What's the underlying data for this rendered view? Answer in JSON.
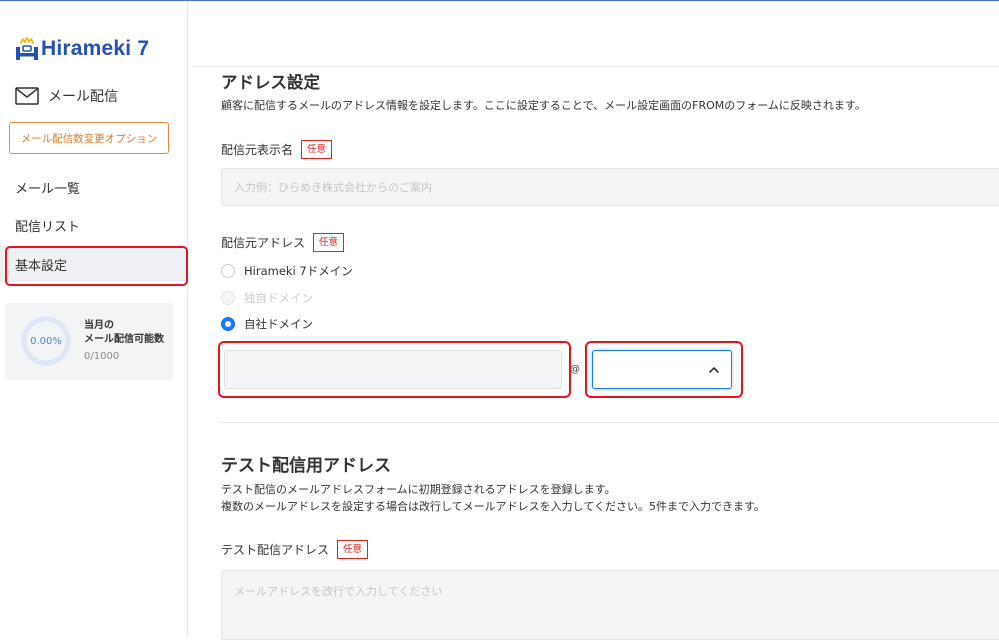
{
  "app": {
    "logo_text": "Hirameki",
    "logo_version": "7"
  },
  "sidebar": {
    "mail_label": "メール配信",
    "option_button": "メール配信数変更オプション",
    "items": [
      {
        "label": "メール一覧"
      },
      {
        "label": "配信リスト"
      },
      {
        "label": "基本設定"
      }
    ],
    "usage": {
      "percent_text": "0.00%",
      "percent_value": 0,
      "title_line1": "当月の",
      "title_line2": "メール配信可能数",
      "count": "0/1000"
    }
  },
  "address_settings": {
    "title": "アドレス設定",
    "description": "顧客に配信するメールのアドレス情報を設定します。ここに設定することで、メール設定画面のFROMのフォームに反映されます。",
    "sender_name": {
      "label": "配信元表示名",
      "badge": "任意",
      "placeholder": "入力例：ひらめき株式会社からのご案内"
    },
    "sender_address": {
      "label": "配信元アドレス",
      "badge": "任意",
      "options": [
        {
          "label": "Hirameki 7ドメイン",
          "state": "unchecked"
        },
        {
          "label": "独自ドメイン",
          "state": "disabled"
        },
        {
          "label": "自社ドメイン",
          "state": "checked"
        }
      ],
      "local_part_value": "",
      "at_sign": "@",
      "domain_value": ""
    }
  },
  "test_address": {
    "title": "テスト配信用アドレス",
    "description_line1": "テスト配信のメールアドレスフォームに初期登録されるアドレスを登録します。",
    "description_line2": "複数のメールアドレスを設定する場合は改行してメールアドレスを入力してください。5件まで入力できます。",
    "field": {
      "label": "テスト配信アドレス",
      "badge": "任意",
      "placeholder": "メールアドレスを改行で入力してください"
    }
  },
  "colors": {
    "brand": "#2550b8",
    "accent_orange": "#e07a26",
    "highlight": "#e8141c",
    "primary": "#1677ff"
  }
}
